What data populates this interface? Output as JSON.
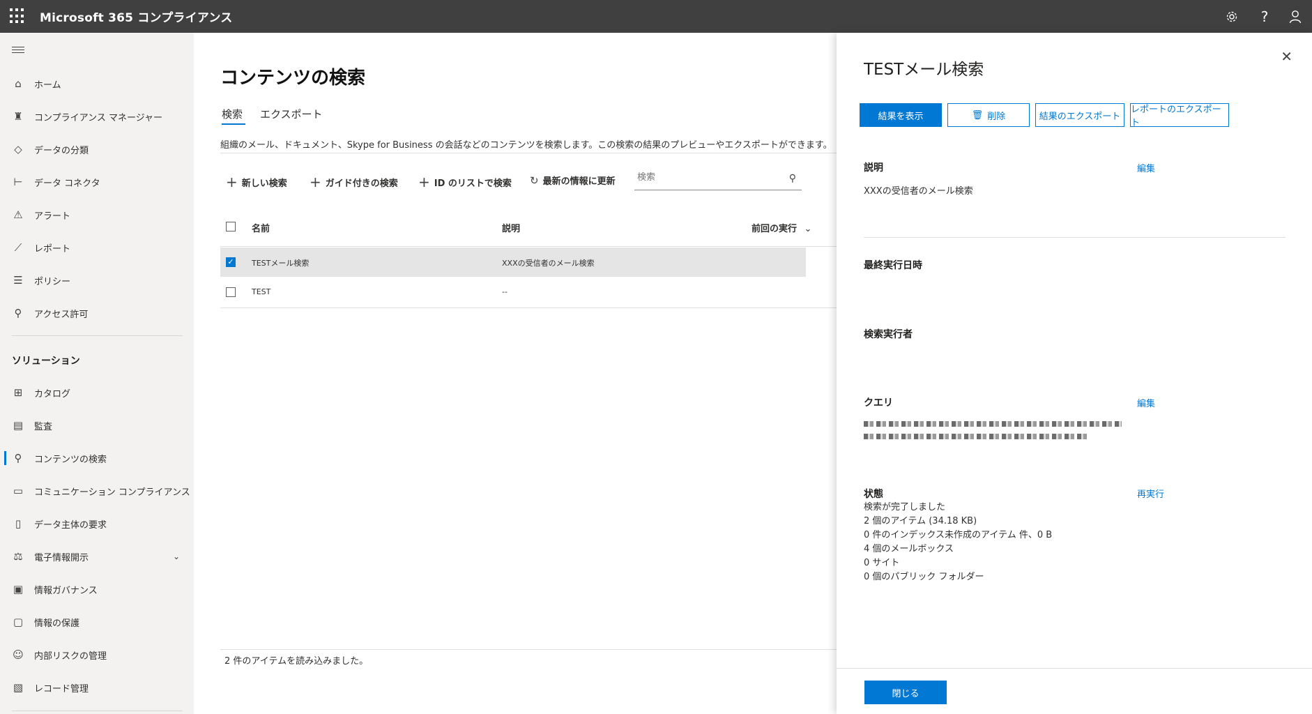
{
  "app": {
    "title": "Microsoft 365 コンプライアンス"
  },
  "topbar": {
    "settings_icon": "gear-icon",
    "help_icon": "question-icon",
    "profile_icon": "person-icon"
  },
  "nav": {
    "items": [
      {
        "label": "ホーム",
        "icon": "home-icon"
      },
      {
        "label": "コンプライアンス マネージャー",
        "icon": "trophy-icon"
      },
      {
        "label": "データの分類",
        "icon": "tag-icon"
      },
      {
        "label": "データ コネクタ",
        "icon": "connector-icon"
      },
      {
        "label": "アラート",
        "icon": "warning-icon"
      },
      {
        "label": "レポート",
        "icon": "chart-icon"
      },
      {
        "label": "ポリシー",
        "icon": "sliders-icon"
      },
      {
        "label": "アクセス許可",
        "icon": "key-icon"
      }
    ],
    "solutions_header": "ソリューション",
    "solutions": [
      {
        "label": "カタログ",
        "icon": "catalog-icon"
      },
      {
        "label": "監査",
        "icon": "audit-icon"
      },
      {
        "label": "コンテンツの検索",
        "icon": "search-icon",
        "active": true
      },
      {
        "label": "コミュニケーション コンプライアンス",
        "icon": "chat-icon"
      },
      {
        "label": "データ主体の要求",
        "icon": "document-person-icon"
      },
      {
        "label": "電子情報開示",
        "icon": "ediscovery-icon",
        "expandable": true
      },
      {
        "label": "情報ガバナンス",
        "icon": "archive-icon"
      },
      {
        "label": "情報の保護",
        "icon": "lock-icon"
      },
      {
        "label": "内部リスクの管理",
        "icon": "risk-person-icon"
      },
      {
        "label": "レコード管理",
        "icon": "records-icon"
      }
    ]
  },
  "main": {
    "title": "コンテンツの検索",
    "tabs": [
      "検索",
      "エクスポート"
    ],
    "description": "組織のメール、ドキュメント、Skype for Business の会話などのコンテンツを検索します。この検索の結果のプレビューやエクスポートができます。",
    "commands": {
      "new_search": "新しい検索",
      "guided_search": "ガイド付きの検索",
      "id_list_search": "ID のリストで検索",
      "refresh": "最新の情報に更新"
    },
    "search_placeholder": "検索",
    "columns": {
      "name": "名前",
      "description": "説明",
      "last_run": "前回の実行"
    },
    "rows": [
      {
        "name": "TESTメール検索",
        "description": "XXXの受信者のメール検索",
        "checked": true
      },
      {
        "name": "TEST",
        "description": "--",
        "checked": false
      }
    ],
    "footer": "2 件のアイテムを読み込みました。"
  },
  "panel": {
    "title": "TESTメール検索",
    "buttons": {
      "show_results": "結果を表示",
      "delete": "削除",
      "export_results": "結果のエクスポート",
      "export_report": "レポートのエクスポート"
    },
    "description_label": "説明",
    "description_value": "XXXの受信者のメール検索",
    "edit_label": "編集",
    "last_run_label": "最終実行日時",
    "run_by_label": "検索実行者",
    "query_label": "クエリ",
    "query_edit_label": "編集",
    "status_label": "状態",
    "rerun_label": "再実行",
    "status_lines": [
      "検索が完了しました",
      "2 個のアイテム (34.18 KB)",
      "0 件のインデックス未作成のアイテム 件、0 B",
      "4 個のメールボックス",
      "0 サイト",
      "0 個のパブリック フォルダー"
    ],
    "close_button": "閉じる"
  },
  "colors": {
    "accent": "#0078d4",
    "topbar": "#404040",
    "nav_bg": "#f3f2f1"
  }
}
